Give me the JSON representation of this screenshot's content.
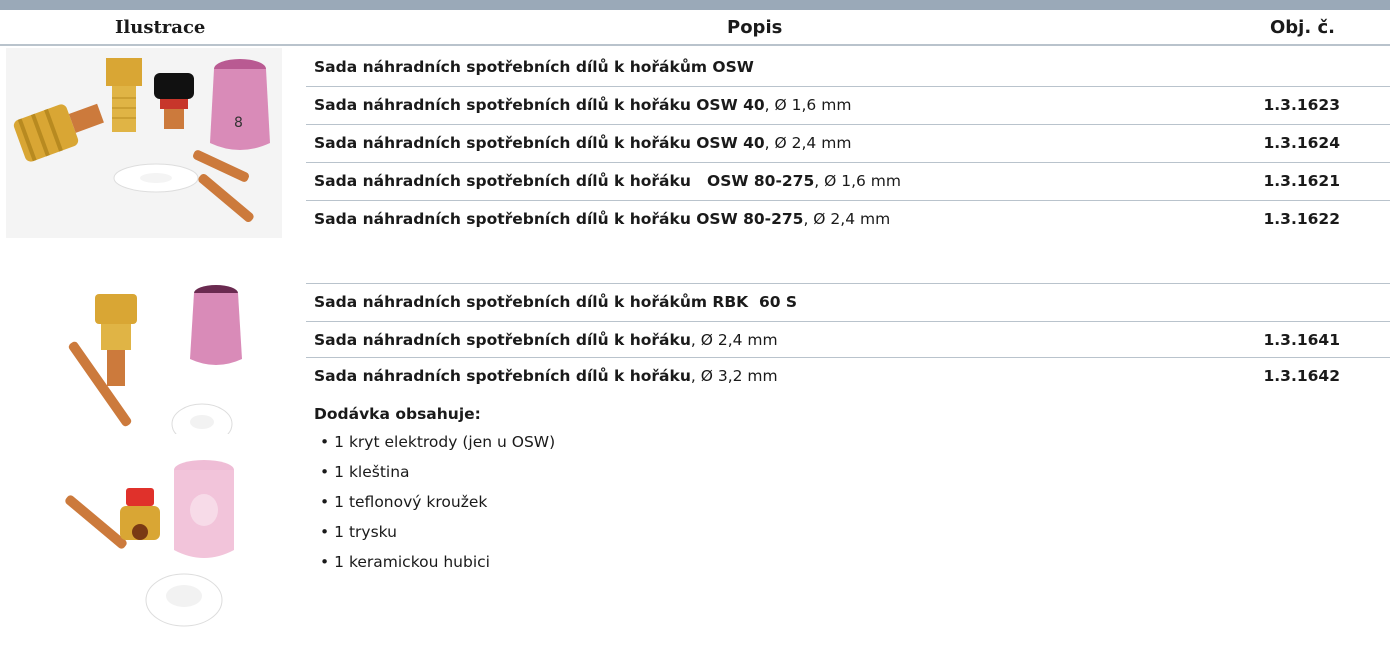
{
  "header": {
    "col1": "Ilustrace",
    "col2": "Popis",
    "col3": "Obj. č."
  },
  "group1": {
    "title": "Sada náhradních spotřebních dílů k hořákům OSW",
    "rows": [
      {
        "name_bold": "Sada náhradních spotřebních dílů k hořáku OSW 40",
        "name_rest": ", Ø 1,6 mm",
        "code": "1.3.1623"
      },
      {
        "name_bold": "Sada náhradních spotřebních dílů k hořáku OSW 40",
        "name_rest": ", Ø 2,4 mm",
        "code": "1.3.1624"
      },
      {
        "name_bold": "Sada náhradních spotřebních dílů k hořáku   OSW 80-275",
        "name_rest": ", Ø 1,6 mm",
        "code": "1.3.1621"
      },
      {
        "name_bold": "Sada náhradních spotřebních dílů k hořáku OSW 80-275",
        "name_rest": ", Ø 2,4 mm",
        "code": "1.3.1622"
      }
    ]
  },
  "group2": {
    "title": "Sada náhradních spotřebních dílů k hořákům RBK  60 S",
    "rows": [
      {
        "name_bold": "Sada náhradních spotřebních dílů k hořáku",
        "name_rest": ", Ø 2,4 mm",
        "code": "1.3.1641"
      },
      {
        "name_bold": "Sada náhradních spotřebních dílů k hořáku",
        "name_rest": ", Ø 3,2 mm",
        "code": "1.3.1642"
      }
    ]
  },
  "delivery": {
    "title": "Dodávka obsahuje:",
    "items": [
      "1 kryt elektrody (jen u OSW)",
      "1 kleština",
      "1 teflonový kroužek",
      "1 trysku",
      "1 keramickou hubici"
    ]
  },
  "colors": {
    "rule": "#b9c3cc",
    "topbar": "#9aa9b8",
    "ceramic": "#d98bb8",
    "brass": "#d9a634",
    "copper": "#cc7a3c"
  }
}
